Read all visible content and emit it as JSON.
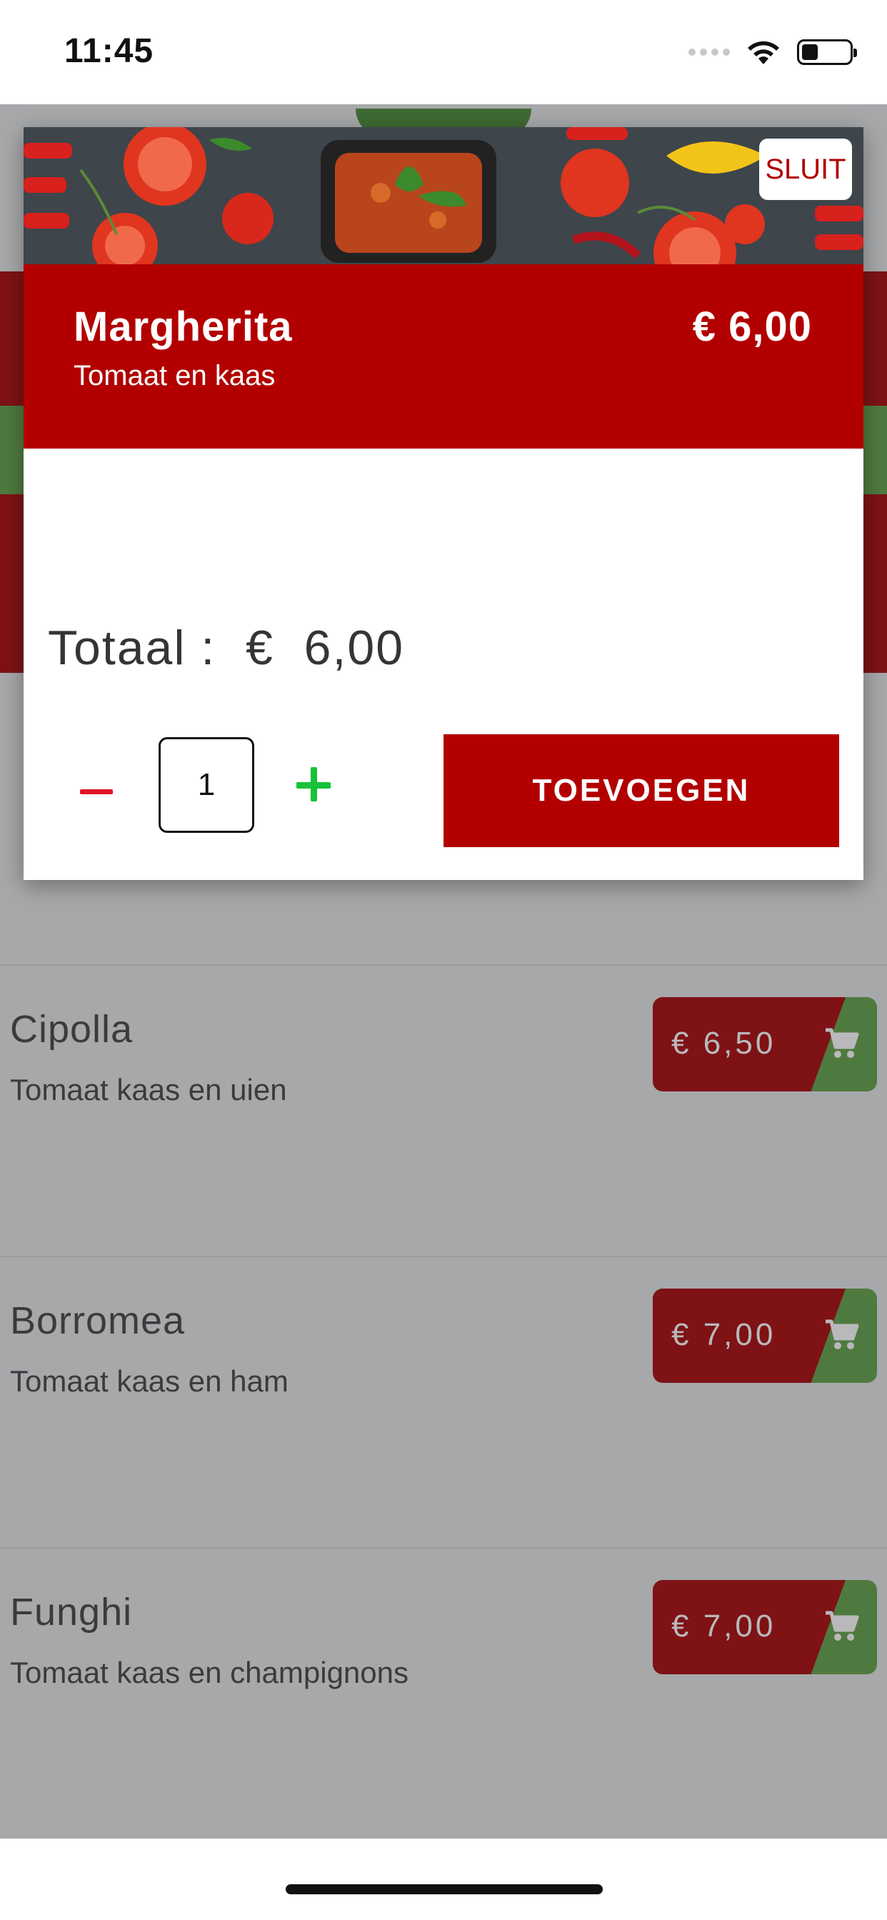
{
  "status_bar": {
    "time": "11:45"
  },
  "modal": {
    "close_label": "SLUIT",
    "title": "Margherita",
    "subtitle": "Tomaat en kaas",
    "price": "€ 6,00",
    "total_label": "Totaal :",
    "total_currency": "€",
    "total_value": "6,00",
    "quantity": "1",
    "add_label": "TOEVOEGEN"
  },
  "menu": {
    "items": [
      {
        "name": "Cipolla",
        "description": "Tomaat kaas en uien",
        "price": "€ 6,50"
      },
      {
        "name": "Borromea",
        "description": "Tomaat kaas en ham",
        "price": "€ 7,00"
      },
      {
        "name": "Funghi",
        "description": "Tomaat kaas en champignons",
        "price": "€ 7,00"
      }
    ]
  },
  "colors": {
    "accent_red": "#b20000",
    "dim_red": "#7e1215",
    "dim_green": "#4f7a3f",
    "plus_green": "#17c23a",
    "minus_red": "#e0102a"
  }
}
